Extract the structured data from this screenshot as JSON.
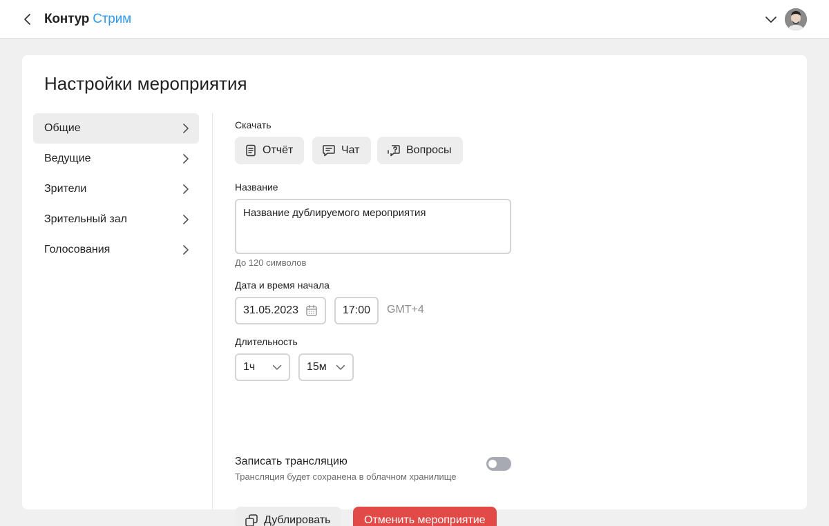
{
  "header": {
    "brand": "Контур",
    "product": "Стрим",
    "back_icon": "chevron-left-icon",
    "account_menu_icon": "chevron-down-icon",
    "avatar": "user-avatar"
  },
  "page": {
    "title": "Настройки мероприятия"
  },
  "sidebar": {
    "items": [
      {
        "label": "Общие",
        "active": true
      },
      {
        "label": "Ведущие",
        "active": false
      },
      {
        "label": "Зрители",
        "active": false
      },
      {
        "label": "Зрительный зал",
        "active": false
      },
      {
        "label": "Голосования",
        "active": false
      }
    ]
  },
  "download": {
    "label": "Скачать",
    "buttons": [
      {
        "label": "Отчёт",
        "icon": "document-icon"
      },
      {
        "label": "Чат",
        "icon": "chat-icon"
      },
      {
        "label": "Вопросы",
        "icon": "question-chat-icon"
      }
    ]
  },
  "name_field": {
    "label": "Название",
    "value": "Название дублируемого мероприятия",
    "hint": "До 120 символов"
  },
  "start": {
    "label": "Дата и время начала",
    "date": "31.05.2023",
    "time": "17:00",
    "timezone": "GMT+4",
    "calendar_icon": "calendar-icon"
  },
  "duration": {
    "label": "Длительность",
    "hours": "1ч",
    "minutes": "15м"
  },
  "record": {
    "label": "Записать трансляцию",
    "hint": "Трансляция будет сохранена в облачном хранилище",
    "enabled": false
  },
  "actions": {
    "duplicate": "Дублировать",
    "cancel": "Отменить мероприятие"
  },
  "colors": {
    "accent": "#2e9bf0",
    "danger": "#e14a46",
    "toggle_off": "#a7aab2"
  }
}
